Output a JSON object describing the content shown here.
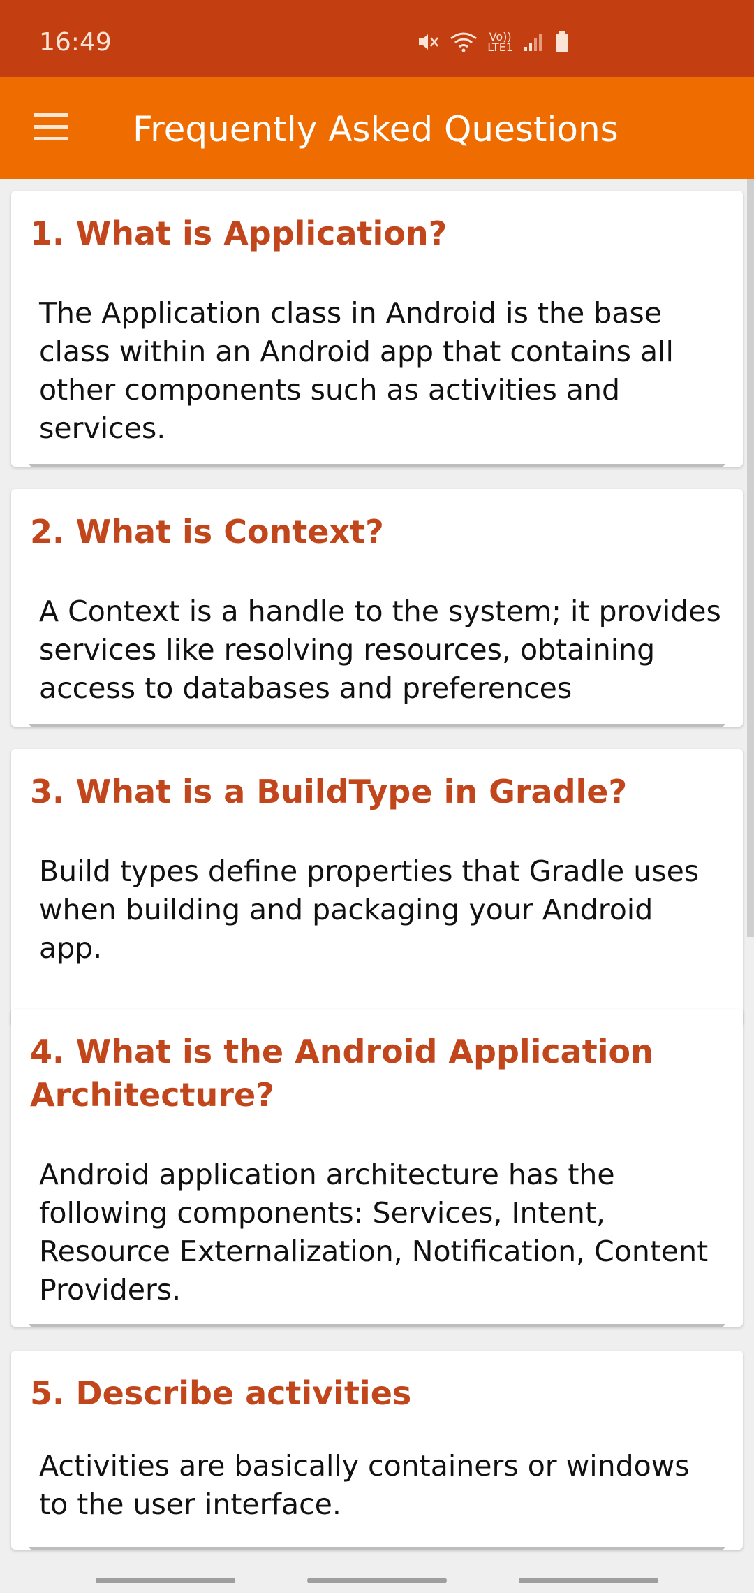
{
  "status_bar": {
    "time": "16:49",
    "lte_label_top": "Vo))",
    "lte_label_bottom": "LTE1",
    "icons": [
      "mute-icon",
      "wifi-icon",
      "lte-icon",
      "signal-icon",
      "battery-icon"
    ]
  },
  "app_bar": {
    "title": "Frequently Asked Questions",
    "menu_icon": "hamburger-menu-icon",
    "background": "#ef6c00"
  },
  "colors": {
    "status_bar": "#c33f12",
    "question_title": "#c2461b",
    "body_text": "#111111"
  },
  "faq": [
    {
      "title": "1. What is Application?",
      "answer": "The Application class in Android is the base class within an Android app that contains all other components such as activities and services."
    },
    {
      "title": "2. What is Context?",
      "answer": "A Context is a handle to the system; it provides services like resolving resources, obtaining access to databases and preferences"
    },
    {
      "title": "3. What is a BuildType in Gradle?",
      "answer": "Build types define properties that Gradle uses when building and packaging your Android app."
    },
    {
      "title": "4. What is the Android Application Architecture?",
      "answer": "Android application architecture has the following components: Services, Intent, Resource Externalization, Notification, Content Providers."
    },
    {
      "title": "5. Describe activities",
      "answer": "Activities are basically containers or windows to the user interface."
    }
  ]
}
